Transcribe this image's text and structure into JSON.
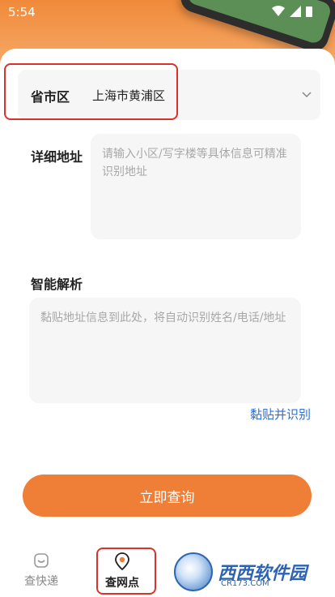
{
  "status_bar": {
    "time": "5:54"
  },
  "form": {
    "region_label": "省市区",
    "region_value": "上海市黄浦区",
    "detail_label": "详细地址",
    "detail_placeholder": "请输入小区/写字楼等具体信息可精准识别地址",
    "smart_label": "智能解析",
    "smart_placeholder": "黏贴地址信息到此处，将自动识别姓名/电话/地址",
    "paste_link": "黏贴并识别",
    "query_button": "立即查询"
  },
  "tabbar": {
    "tabs": [
      {
        "label": "查快递",
        "icon": "package-icon",
        "active": false
      },
      {
        "label": "查网点",
        "icon": "location-pin-icon",
        "active": true
      }
    ]
  },
  "watermark": {
    "text": "西西软件园",
    "sub": "CR173.COM"
  },
  "colors": {
    "accent": "#ef7e36",
    "link": "#2d6fd6",
    "highlight": "#d9322b"
  }
}
